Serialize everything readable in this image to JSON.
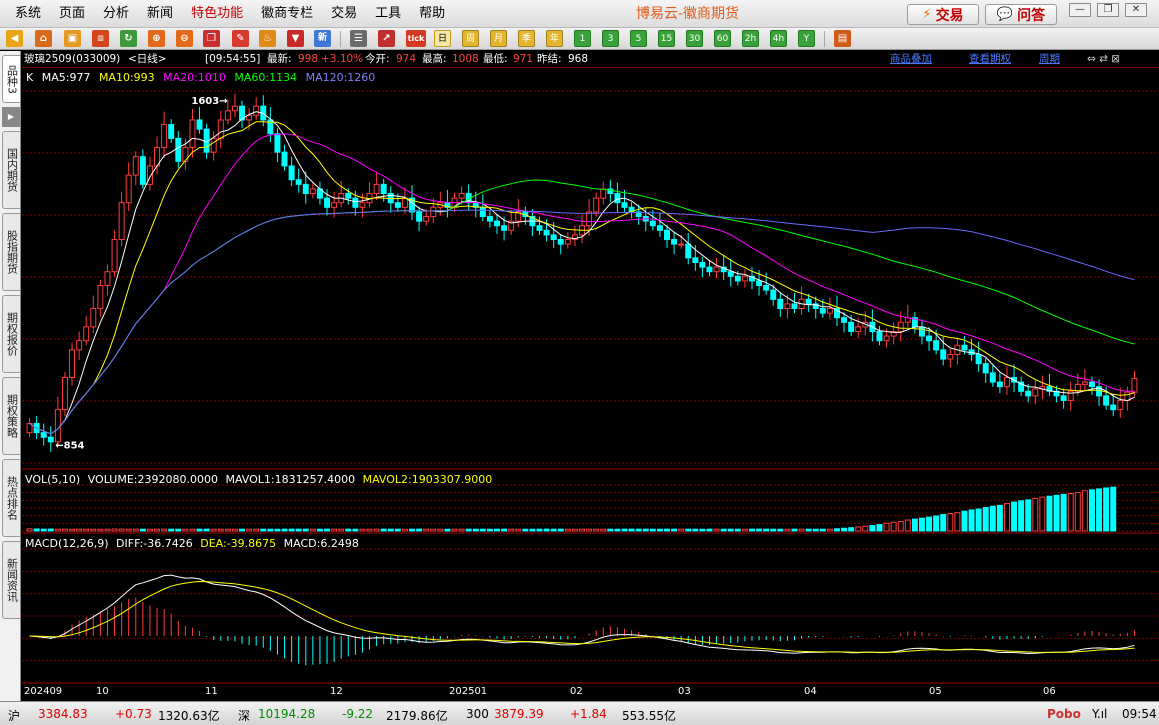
{
  "menu": {
    "items": [
      "系统",
      "页面",
      "分析",
      "新闻",
      "特色功能",
      "徽商专栏",
      "交易",
      "工具",
      "帮助"
    ],
    "app_title": "博易云-徽商期货",
    "trade_button": "交易",
    "qa_button": "问答"
  },
  "toolbar": {
    "icons": [
      "back-arrow-icon",
      "home-icon",
      "cube-icon",
      "tick-chart-icon",
      "refresh-icon",
      "zoom-in-icon",
      "zoom-out-icon",
      "windows-icon",
      "pencil-icon",
      "bell-icon",
      "filter-icon",
      "news-icon",
      "table-icon",
      "trend-icon",
      "tick-icon"
    ],
    "tick_label": "tick",
    "periods": [
      "日",
      "周",
      "月",
      "季",
      "年",
      "1",
      "3",
      "5",
      "15",
      "30",
      "60",
      "2h",
      "4h",
      "Y"
    ],
    "selected_period": "日"
  },
  "sidebar": {
    "tabs": [
      "品种3",
      "国内期货",
      "股指期货",
      "期权报价",
      "期权策略",
      "热点排名",
      "新闻资讯"
    ]
  },
  "quote": {
    "symbol": "玻璃2509",
    "code": "(033009)",
    "period": "<日线>",
    "time": "[09:54:55]",
    "latest_label": "最新:",
    "latest": "998",
    "change_pct": "+3.10%",
    "open_label": "今开:",
    "open": "974",
    "high_label": "最高:",
    "high": "1008",
    "low_label": "最低:",
    "low": "971",
    "prev_label": "昨结:",
    "prev": "968",
    "links": [
      "商品叠加",
      "查看期权",
      "周期"
    ]
  },
  "indicators": {
    "k": "K",
    "ma5": "MA5:977",
    "ma10": "MA10:993",
    "ma20": "MA20:1010",
    "ma60": "MA60:1134",
    "ma120": "MA120:1260",
    "high_mark": "1603",
    "low_mark": "854",
    "vol_title": "VOL(5,10)",
    "volume": "VOLUME:2392080.0000",
    "mavol1": "MAVOL1:1831257.4000",
    "mavol2": "MAVOL2:1903307.9000",
    "macd_title": "MACD(12,26,9)",
    "diff": "DIFF:-36.7426",
    "dea": "DEA:-39.8675",
    "macd": "MACD:6.2498"
  },
  "colors": {
    "ma5": "#ffffff",
    "ma10": "#ffff00",
    "ma20": "#ff00ff",
    "ma60": "#00ff00",
    "ma120": "#6a6aff",
    "up": "#ff3b3b",
    "down": "#00ffff",
    "grid": "#7a0000"
  },
  "date_axis": [
    "202409",
    "10",
    "11",
    "12",
    "202501",
    "02",
    "03",
    "04",
    "05",
    "06"
  ],
  "status": {
    "sh_label": "沪",
    "sh_index": "3384.83",
    "sh_change": "+0.73",
    "sh_amount": "1320.63亿",
    "sz_label": "深",
    "sz_index": "10194.28",
    "sz_change": "-9.22",
    "sz_amount": "2179.86亿",
    "h300_label": "300",
    "h300_index": "3879.39",
    "h300_change": "+1.84",
    "h300_amount": "553.55亿",
    "brand": "Pobo",
    "signal": "Y.ıl",
    "clock": "09:54"
  },
  "chart_data": {
    "type": "candlestick",
    "symbol": "玻璃2509",
    "period": "daily",
    "price_high": 1603,
    "price_low": 854,
    "ma": {
      "MA5": 977,
      "MA10": 993,
      "MA20": 1010,
      "MA60": 1134,
      "MA120": 1260
    },
    "closes": [
      900,
      880,
      870,
      860,
      930,
      1000,
      1060,
      1080,
      1110,
      1150,
      1200,
      1230,
      1300,
      1380,
      1440,
      1480,
      1420,
      1460,
      1500,
      1550,
      1520,
      1470,
      1500,
      1560,
      1540,
      1490,
      1520,
      1560,
      1580,
      1590,
      1560,
      1570,
      1590,
      1560,
      1530,
      1490,
      1460,
      1430,
      1420,
      1400,
      1410,
      1390,
      1370,
      1380,
      1400,
      1390,
      1370,
      1380,
      1400,
      1420,
      1400,
      1380,
      1370,
      1390,
      1360,
      1340,
      1350,
      1370,
      1380,
      1370,
      1390,
      1400,
      1380,
      1370,
      1350,
      1340,
      1330,
      1320,
      1340,
      1360,
      1350,
      1330,
      1320,
      1310,
      1300,
      1290,
      1300,
      1310,
      1330,
      1360,
      1390,
      1410,
      1400,
      1380,
      1370,
      1360,
      1350,
      1340,
      1330,
      1320,
      1300,
      1290,
      1290,
      1260,
      1250,
      1240,
      1230,
      1240,
      1230,
      1220,
      1210,
      1220,
      1210,
      1200,
      1190,
      1170,
      1150,
      1160,
      1150,
      1170,
      1160,
      1150,
      1140,
      1150,
      1130,
      1120,
      1100,
      1110,
      1120,
      1100,
      1080,
      1090,
      1100,
      1120,
      1130,
      1110,
      1090,
      1080,
      1060,
      1040,
      1050,
      1070,
      1060,
      1050,
      1030,
      1010,
      990,
      980,
      1000,
      990,
      970,
      960,
      975,
      980,
      970,
      960,
      950,
      970,
      985,
      990,
      980,
      960,
      940,
      930,
      950,
      968,
      998
    ],
    "volume": [
      120000,
      110000,
      100000,
      105000,
      98000,
      102000,
      95000,
      99000,
      97000,
      96000,
      94000,
      100000,
      110000,
      105000,
      98000,
      102000,
      97000,
      95000,
      99000,
      101000,
      98000,
      96000,
      95000,
      97000,
      99000,
      100000,
      98000,
      97000,
      96000,
      95000,
      99000,
      100000,
      98000,
      97000,
      96000,
      95000,
      99000,
      100000,
      98000,
      97000,
      96000,
      95000,
      99000,
      100000,
      98000,
      97000,
      96000,
      95000,
      99000,
      100000,
      98000,
      97000,
      96000,
      95000,
      99000,
      100000,
      98000,
      97000,
      96000,
      95000,
      99000,
      100000,
      98000,
      97000,
      96000,
      95000,
      99000,
      100000,
      98000,
      97000,
      96000,
      95000,
      99000,
      100000,
      98000,
      97000,
      96000,
      95000,
      99000,
      100000,
      98000,
      97000,
      96000,
      95000,
      99000,
      100000,
      98000,
      97000,
      96000,
      95000,
      99000,
      100000,
      98000,
      97000,
      96000,
      95000,
      99000,
      100000,
      98000,
      97000,
      96000,
      95000,
      99000,
      100000,
      98000,
      97000,
      96000,
      95000,
      99000,
      100000,
      98000,
      97000,
      96000,
      95000,
      120000,
      150000,
      180000,
      220000,
      260000,
      300000,
      350000,
      420000,
      480000,
      520000,
      600000,
      650000,
      700000,
      760000,
      820000,
      900000,
      950000,
      1000000,
      1080000,
      1150000,
      1200000,
      1280000,
      1350000,
      1400000,
      1500000,
      1580000,
      1650000,
      1700000,
      1780000,
      1850000,
      1900000,
      1950000,
      2000000,
      2050000,
      2100000,
      2200000,
      2250000,
      2300000,
      2350000,
      2392080
    ],
    "macd_latest": {
      "DIFF": -36.7426,
      "DEA": -39.8675,
      "MACD": 6.2498
    }
  }
}
